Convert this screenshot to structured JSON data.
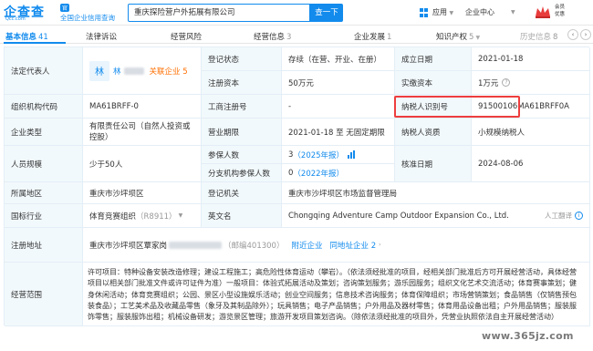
{
  "header": {
    "logo_text": "企查查",
    "logo_domain": "Qcc.com",
    "logo_badge": "官",
    "logo_slogan": "全国企业信用查询",
    "search_value": "重庆探险营户外拓展有限公司",
    "search_button": "查一下",
    "apps_label": "应用",
    "enterprise_center": "企业中心",
    "vip_line1": "会员",
    "vip_line2": "优惠"
  },
  "tabs": [
    {
      "label": "基本信息",
      "count": "41"
    },
    {
      "label": "法律诉讼",
      "count": ""
    },
    {
      "label": "经营风险",
      "count": ""
    },
    {
      "label": "经营信息",
      "count": "3"
    },
    {
      "label": "企业发展",
      "count": "1"
    },
    {
      "label": "知识产权",
      "count": "5"
    },
    {
      "label": "历史信息",
      "count": "8"
    }
  ],
  "table": {
    "legal_rep_label": "法定代表人",
    "legal_rep_avatar": "林",
    "legal_rep_name": "林",
    "assoc_label": "关联企业",
    "assoc_count": "5",
    "reg_status_label": "登记状态",
    "reg_status_value": "存续（在营、开业、在册）",
    "found_date_label": "成立日期",
    "found_date_value": "2021-01-18",
    "reg_capital_label": "注册资本",
    "reg_capital_value": "50万元",
    "paid_capital_label": "实缴资本",
    "paid_capital_value": "1万元",
    "org_code_label": "组织机构代码",
    "org_code_value": "MA61BRFF-0",
    "biz_reg_no_label": "工商注册号",
    "biz_reg_no_value": "-",
    "taxpayer_id_label": "纳税人识别号",
    "taxpayer_id_value": "91500106MA61BRFF0A",
    "company_type_label": "企业类型",
    "company_type_value": "有限责任公司（自然人投资或控股）",
    "biz_term_label": "营业期限",
    "biz_term_value": "2021-01-18 至 无固定期限",
    "taxpayer_qual_label": "纳税人资质",
    "taxpayer_qual_value": "小规模纳税人",
    "staff_size_label": "人员规模",
    "staff_size_value": "少于50人",
    "insured_label": "参保人数",
    "insured_value": "3",
    "insured_year": "（2025年报）",
    "branch_insured_label": "分支机构参保人数",
    "branch_insured_value": "0",
    "branch_insured_year": "（2022年报）",
    "approval_date_label": "核准日期",
    "approval_date_value": "2024-08-06",
    "region_label": "所属地区",
    "region_value": "重庆市沙坪坝区",
    "reg_authority_label": "登记机关",
    "reg_authority_value": "重庆市沙坪坝区市场监督管理局",
    "industry_label": "国标行业",
    "industry_value": "体育竞赛组织",
    "industry_code": "（R8911）",
    "english_name_label": "英文名",
    "english_name_value": "Chongqing Adventure Camp Outdoor Expansion Co., Ltd.",
    "translate_hint": "人工翻译",
    "address_label": "注册地址",
    "address_value": "重庆市沙坪坝区覃家岗",
    "postcode": "（邮编401300）",
    "nearby_label": "附近企业",
    "same_address_label": "同地址企业",
    "same_address_count": "2",
    "scope_label": "经营范围",
    "scope_value": "许可项目：特种设备安装改造修理；建设工程施工；高危险性体育运动（攀岩）。（依法须经批准的项目，经相关部门批准后方可开展经营活动，具体经营项目以相关部门批准文件或许可证件为准）一般项目：体验式拓展活动及策划；咨询策划服务；游乐园服务；组织文化艺术交流活动；体育赛事策划；健身休闲活动；体育竞赛组织；公园、景区小型设施娱乐活动；创业空间服务；信息技术咨询服务；体育保障组织；市场营销策划；食品销售（仅销售预包装食品）；工艺美术品及收藏品零售（象牙及其制品除外）；玩具销售；电子产品销售；户外用品及器材零售；体育用品设备出租；户外用品销售；服装服饰零售；服装服饰出租；机械设备研发；游览景区管理；旅游开发项目策划咨询。（除依法须经批准的项目外，凭营业执照依法自主开展经营活动）"
  },
  "watermark": "www.365jz.com",
  "colors": {
    "accent": "#128bed",
    "highlight": "#ee3e3e",
    "label_bg": "#f2f9fc"
  }
}
